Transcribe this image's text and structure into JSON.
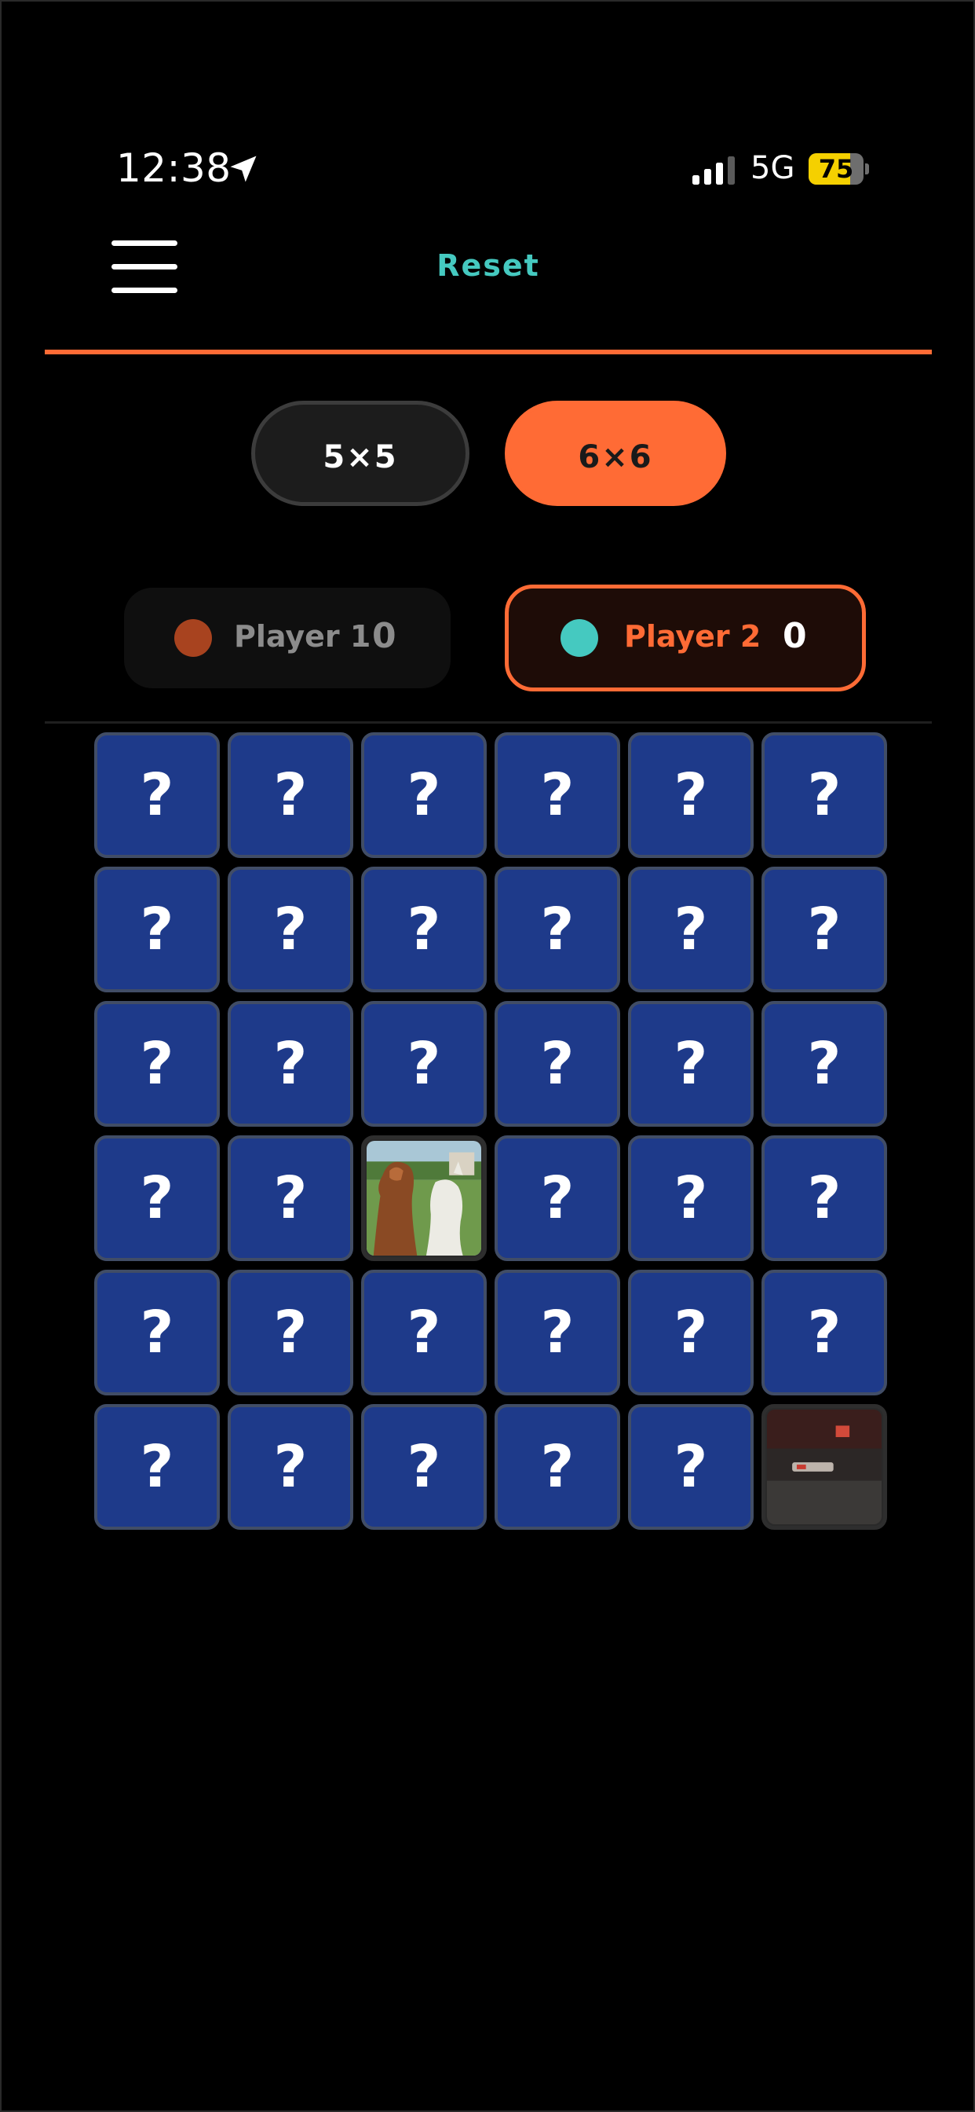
{
  "status_bar": {
    "time": "12:38",
    "network": "5G",
    "battery": "75",
    "battery_fraction": 0.75,
    "icons": [
      "location-arrow-icon",
      "signal-bars-icon",
      "battery-icon"
    ]
  },
  "header": {
    "menu_icon": "hamburger-menu-icon",
    "reset_label": "Reset"
  },
  "grid_sizes": {
    "options": [
      "5×5",
      "6×6"
    ],
    "selected": "6×6"
  },
  "players": [
    {
      "name": "Player 1",
      "score": "0",
      "color": "#a8431f",
      "active": false
    },
    {
      "name": "Player 2",
      "score": "0",
      "color": "#45c9c0",
      "active": true
    }
  ],
  "board": {
    "size": 6,
    "hidden_mark": "?",
    "tiles": [
      [
        "?",
        "?",
        "?",
        "?",
        "?",
        "?"
      ],
      [
        "?",
        "?",
        "?",
        "?",
        "?",
        "?"
      ],
      [
        "?",
        "?",
        "?",
        "?",
        "?",
        "?"
      ],
      [
        "?",
        "?",
        "alpaca-photo",
        "?",
        "?",
        "?"
      ],
      [
        "?",
        "?",
        "?",
        "?",
        "?",
        "?"
      ],
      [
        "?",
        "?",
        "?",
        "?",
        "?",
        "dark-room-photo"
      ]
    ]
  },
  "colors": {
    "background": "#000000",
    "accent": "#ff6b35",
    "reset": "#45c9c0",
    "tile": "#1e3a8a"
  }
}
